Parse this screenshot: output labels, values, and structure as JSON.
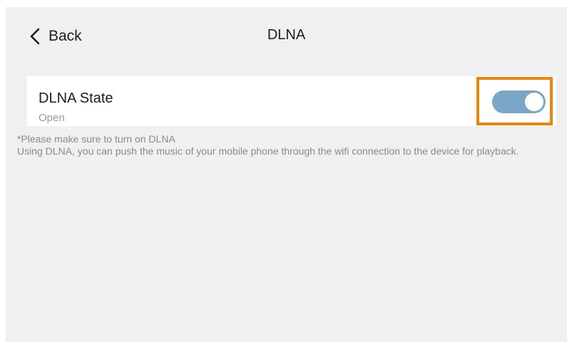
{
  "header": {
    "back_label": "Back",
    "title": "DLNA",
    "back_icon": "chevron-left-icon"
  },
  "setting": {
    "title": "DLNA State",
    "status": "Open",
    "toggle_on": true
  },
  "note": {
    "line1": "*Please make sure to turn on DLNA",
    "line2": "Using DLNA, you can push the music of your mobile phone through the wifi connection to the device for playback."
  },
  "colors": {
    "background": "#f0f0f0",
    "toggle_track": "#7aa7c6",
    "highlight_border": "#e8870f"
  }
}
